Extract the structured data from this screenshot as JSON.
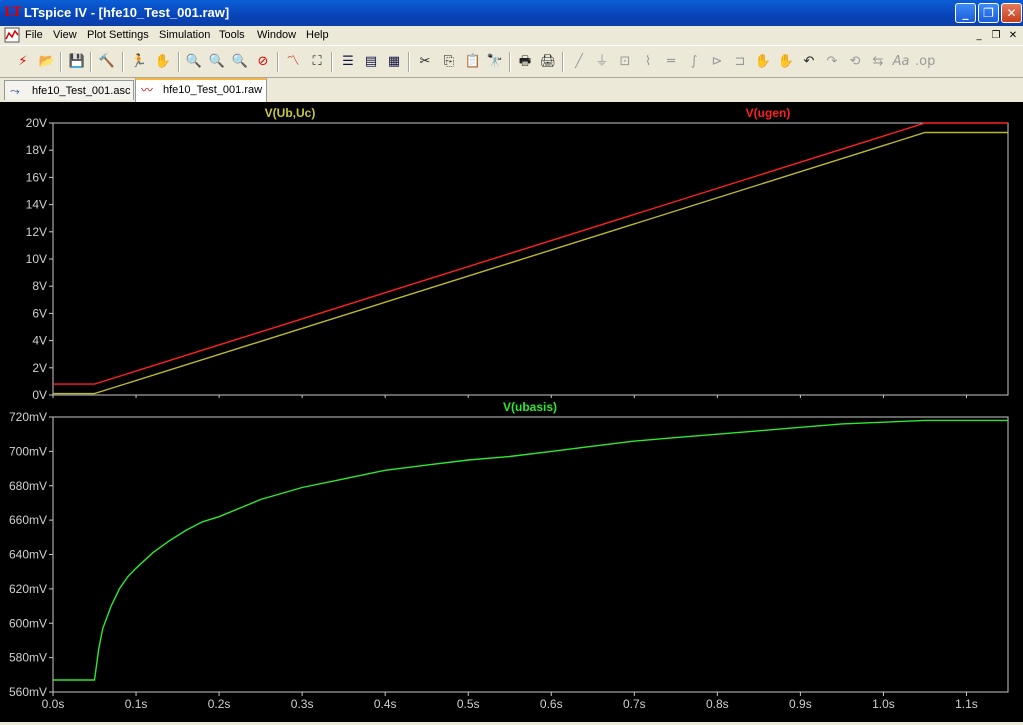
{
  "window": {
    "title": "LTspice IV - [hfe10_Test_001.raw]"
  },
  "menu": [
    "File",
    "View",
    "Plot Settings",
    "Simulation",
    "Tools",
    "Window",
    "Help"
  ],
  "tabs": [
    {
      "label": "hfe10_Test_001.asc",
      "icon": "schematic-icon",
      "active": false
    },
    {
      "label": "hfe10_Test_001.raw",
      "icon": "waveform-icon",
      "active": true
    }
  ],
  "colors": {
    "ugen": "#ff2020",
    "ubuc": "#b8b82a",
    "ubasis": "#2ee82e",
    "axis": "#e0e0e0",
    "label": "#d0d0d0"
  },
  "plot": {
    "top_pane": {
      "traces": [
        {
          "label": "V(Ub,Uc)",
          "color": "#c8c83a"
        },
        {
          "label": "V(ugen)",
          "color": "#ff2020"
        }
      ],
      "y_ticks": [
        "0V",
        "2V",
        "4V",
        "6V",
        "8V",
        "10V",
        "12V",
        "14V",
        "16V",
        "18V",
        "20V"
      ]
    },
    "bottom_pane": {
      "traces": [
        {
          "label": "V(ubasis)",
          "color": "#2ee82e"
        }
      ],
      "y_ticks": [
        "560mV",
        "580mV",
        "600mV",
        "620mV",
        "640mV",
        "660mV",
        "680mV",
        "700mV",
        "720mV"
      ]
    },
    "x_ticks": [
      "0.0s",
      "0.1s",
      "0.2s",
      "0.3s",
      "0.4s",
      "0.5s",
      "0.6s",
      "0.7s",
      "0.8s",
      "0.9s",
      "1.0s",
      "1.1s"
    ]
  },
  "chart_data": [
    {
      "type": "line",
      "xlim": [
        0,
        1.15
      ],
      "ylim": [
        0,
        20
      ],
      "series": [
        {
          "name": "V(ugen)",
          "x": [
            0,
            0.05,
            1.05,
            1.15
          ],
          "values": [
            0.8,
            0.8,
            20.0,
            20.0
          ]
        },
        {
          "name": "V(Ub,Uc)",
          "x": [
            0,
            0.05,
            1.05,
            1.15
          ],
          "values": [
            0.1,
            0.1,
            19.3,
            19.3
          ]
        }
      ]
    },
    {
      "type": "line",
      "xlim": [
        0,
        1.15
      ],
      "ylim": [
        560,
        720
      ],
      "series": [
        {
          "name": "V(ubasis)",
          "x": [
            0,
            0.05,
            0.055,
            0.06,
            0.07,
            0.08,
            0.09,
            0.1,
            0.12,
            0.14,
            0.16,
            0.18,
            0.2,
            0.25,
            0.3,
            0.35,
            0.4,
            0.45,
            0.5,
            0.55,
            0.6,
            0.65,
            0.7,
            0.75,
            0.8,
            0.85,
            0.9,
            0.95,
            1.0,
            1.05,
            1.15
          ],
          "values": [
            567,
            567,
            585,
            597,
            610,
            620,
            627,
            632,
            641,
            648,
            654,
            659,
            662,
            672,
            679,
            684,
            689,
            692,
            695,
            697,
            700,
            703,
            706,
            708,
            710,
            712,
            714,
            716,
            717,
            718,
            718
          ]
        }
      ]
    }
  ]
}
